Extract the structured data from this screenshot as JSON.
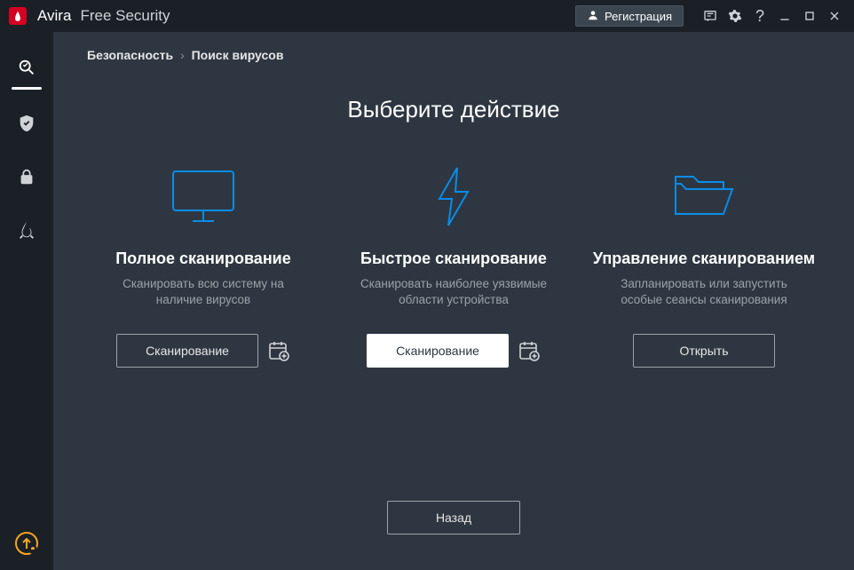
{
  "brand": {
    "name": "Avira",
    "suffix": "Free Security"
  },
  "titlebar": {
    "register": "Регистрация"
  },
  "breadcrumb": {
    "root": "Безопасность",
    "sep": "›",
    "current": "Поиск вирусов"
  },
  "page": {
    "title": "Выберите действие"
  },
  "cards": {
    "full": {
      "title": "Полное сканирование",
      "desc": "Сканировать всю систему на наличие вирусов",
      "button": "Сканирование"
    },
    "quick": {
      "title": "Быстрое сканирование",
      "desc": "Сканировать наиболее уязвимые области устройства",
      "button": "Сканирование"
    },
    "manage": {
      "title": "Управление сканированием",
      "desc": "Запланировать или запустить особые сеансы сканирования",
      "button": "Открыть"
    }
  },
  "back": "Назад"
}
